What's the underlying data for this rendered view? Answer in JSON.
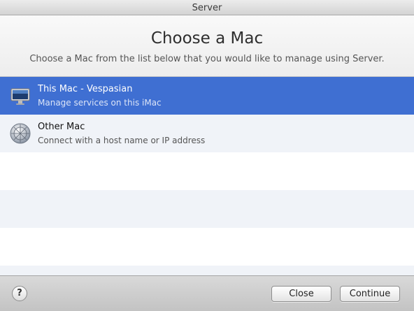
{
  "window": {
    "title": "Server"
  },
  "header": {
    "title": "Choose a Mac",
    "subtitle": "Choose a Mac from the list below that you would like to manage using Server."
  },
  "list": {
    "items": [
      {
        "title": "This Mac - Vespasian",
        "subtitle": "Manage services on this iMac",
        "icon": "imac-icon",
        "selected": true
      },
      {
        "title": "Other Mac",
        "subtitle": "Connect with a host name or IP address",
        "icon": "network-globe-icon",
        "selected": false
      }
    ]
  },
  "footer": {
    "help_label": "?",
    "close_label": "Close",
    "continue_label": "Continue"
  },
  "colors": {
    "selection": "#3f6fd2",
    "alt_row": "#f0f3f8"
  }
}
